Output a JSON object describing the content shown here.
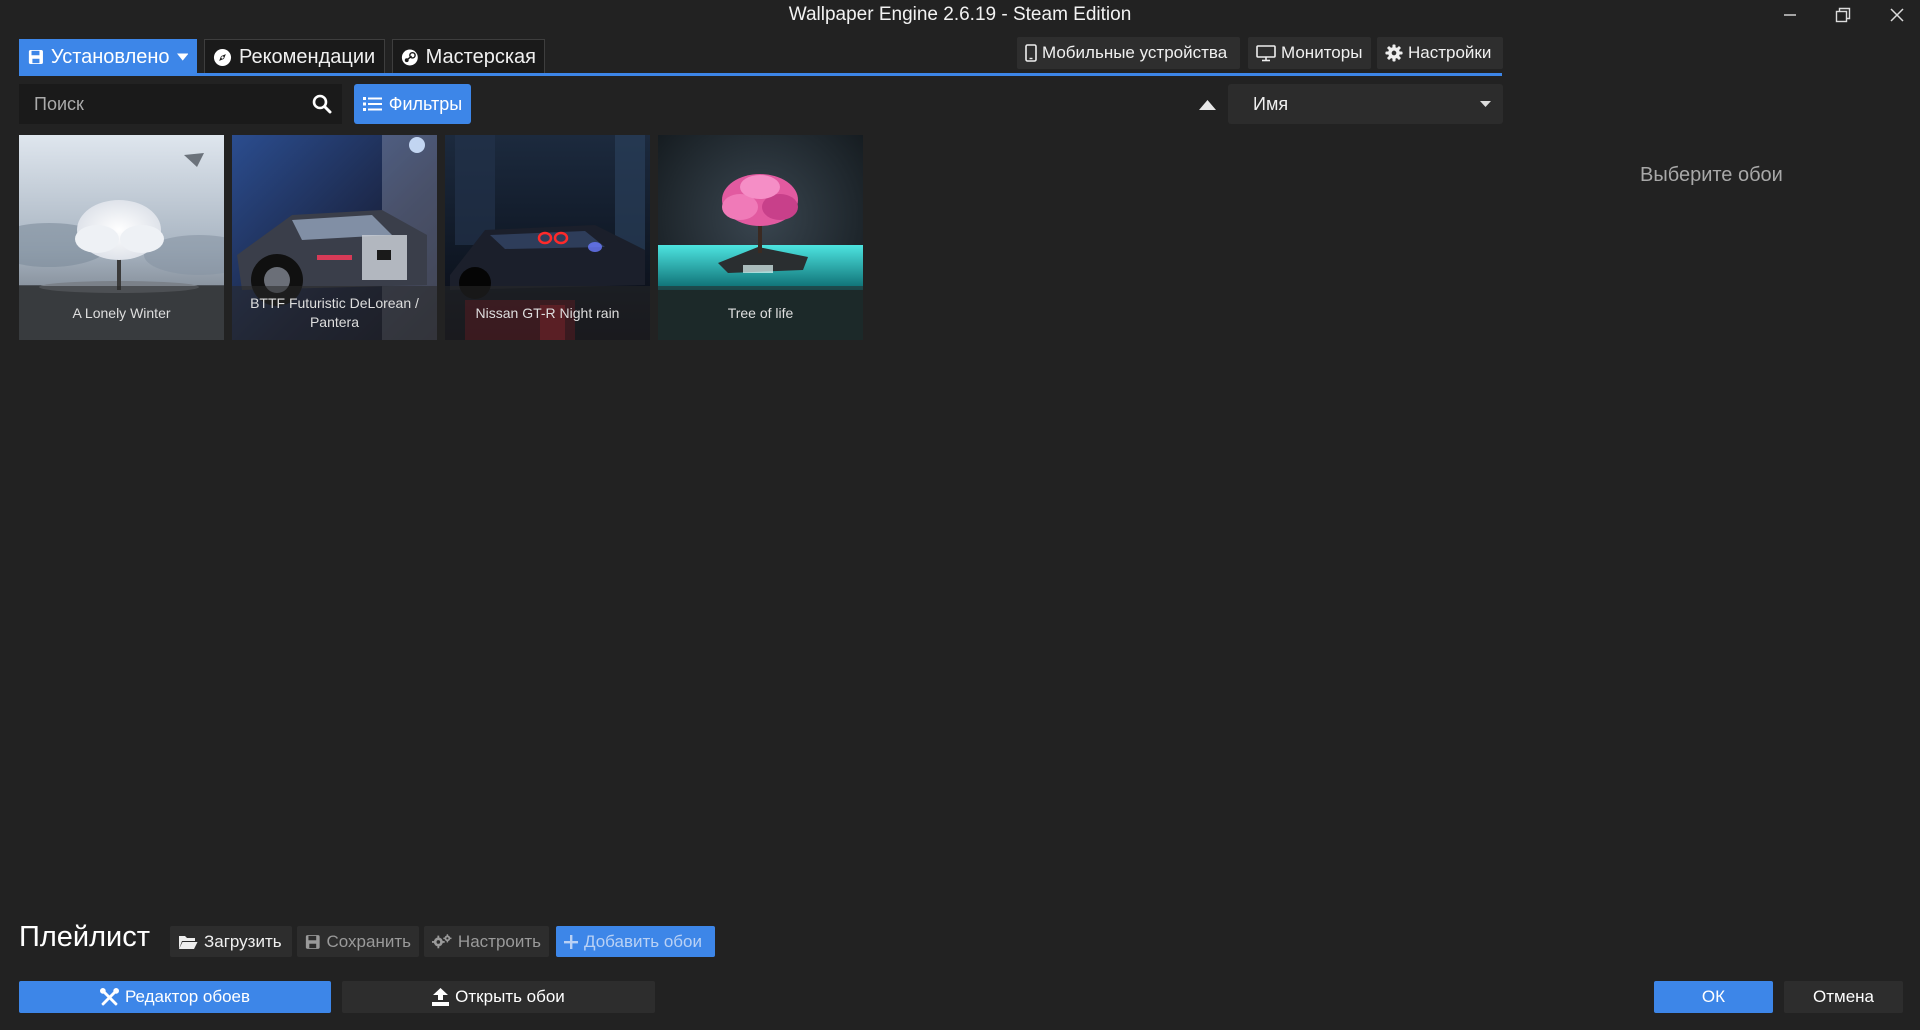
{
  "window": {
    "title": "Wallpaper Engine 2.6.19 - Steam Edition"
  },
  "tabs": [
    {
      "label": "Установлено",
      "icon": "save-icon"
    },
    {
      "label": "Рекомендации",
      "icon": "compass-icon"
    },
    {
      "label": "Мастерская",
      "icon": "steam-icon"
    }
  ],
  "top_right": {
    "mobile": "Мобильные устройства",
    "monitors": "Мониторы",
    "settings": "Настройки"
  },
  "search": {
    "placeholder": "Поиск"
  },
  "filters_label": "Фильтры",
  "sort": {
    "selected": "Имя"
  },
  "wallpapers": [
    {
      "title": "A Lonely Winter"
    },
    {
      "title": "BTTF Futuristic DeLorean / Pantera"
    },
    {
      "title": "Nissan GT-R Night rain"
    },
    {
      "title": "Tree of life"
    }
  ],
  "details_hint": "Выберите обои",
  "playlist": {
    "title": "Плейлист",
    "load": "Загрузить",
    "save": "Сохранить",
    "configure": "Настроить",
    "add": "Добавить обои"
  },
  "footer": {
    "editor": "Редактор обоев",
    "open": "Открыть обои",
    "ok": "ОК",
    "cancel": "Отмена"
  },
  "colors": {
    "accent": "#3d86e8",
    "background": "#222222",
    "panel": "#2d2d2d"
  }
}
